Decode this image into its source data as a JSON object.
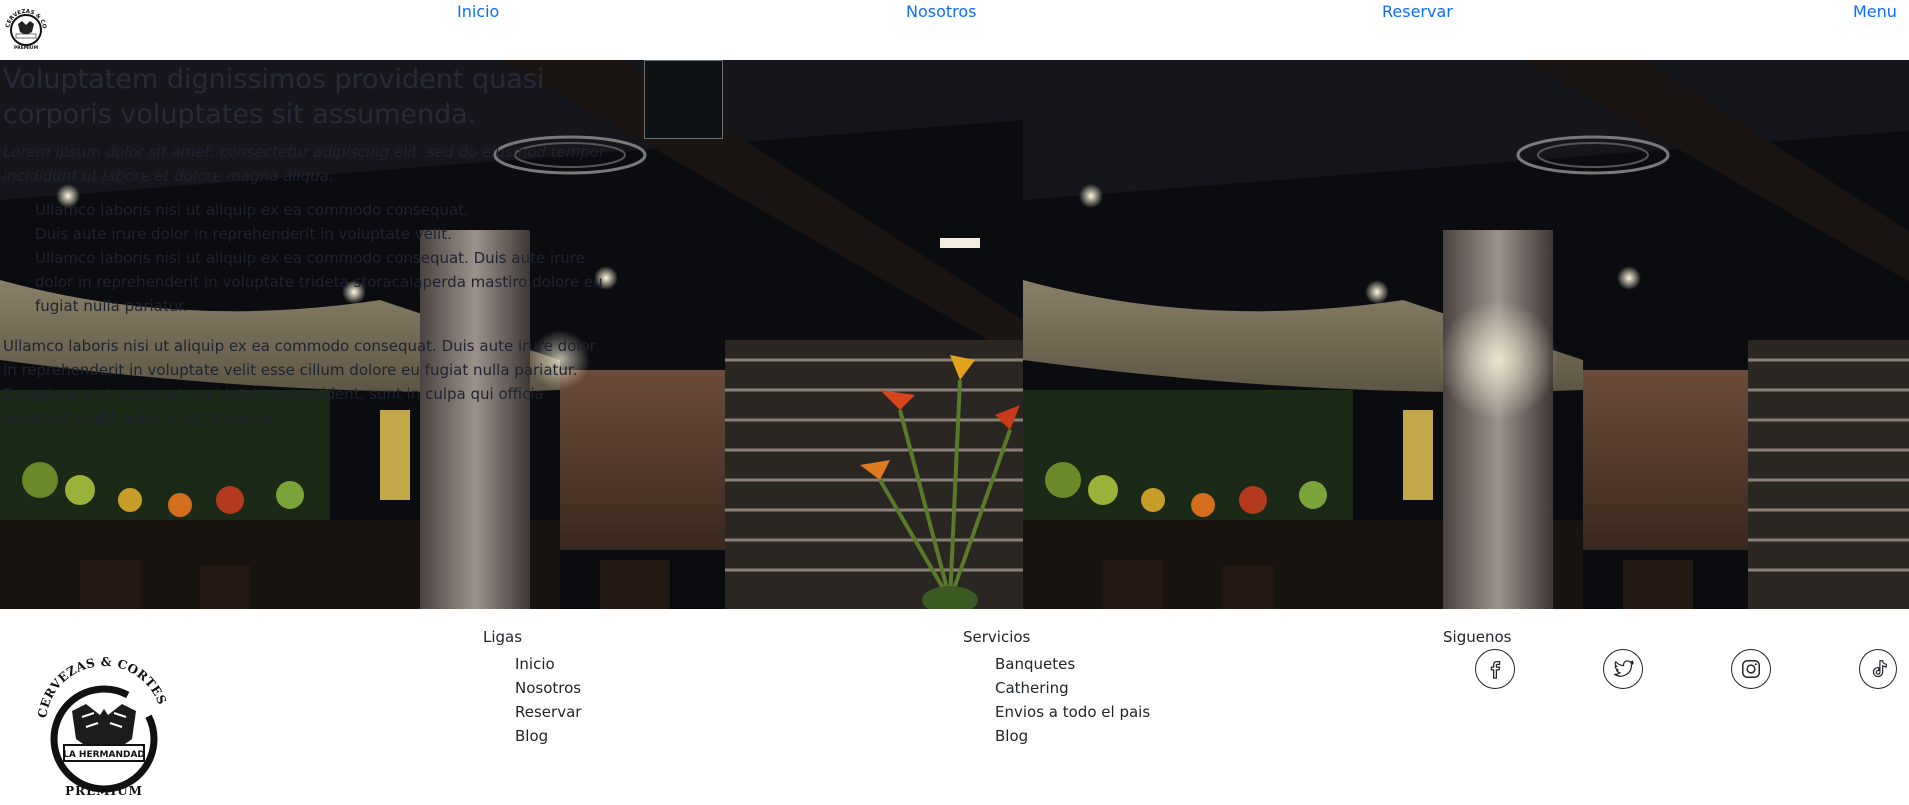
{
  "header": {
    "logo_alt": "Cervezas & Cortes La Hermandad Premium",
    "nav": [
      "Inicio",
      "Nosotros",
      "Reservar",
      "Menu"
    ]
  },
  "hero": {
    "title": "Voluptatem dignissimos provident quasi corporis voluptates sit assumenda.",
    "lead": "Lorem ipsum dolor sit amet, consectetur adipiscing elit, sed do eiusmod tempor incididunt ut labore et dolore magna aliqua.",
    "list": [
      "Ullamco laboris nisi ut aliquip ex ea commodo consequat.",
      "Duis aute irure dolor in reprehenderit in voluptate velit.",
      "Ullamco laboris nisi ut aliquip ex ea commodo consequat. Duis aute irure dolor in reprehenderit in voluptate trideta storacalaperda mastiro dolore eu fugiat nulla pariatur."
    ],
    "paragraph": "Ullamco laboris nisi ut aliquip ex ea commodo consequat. Duis aute irure dolor in reprehenderit in voluptate velit esse cillum dolore eu fugiat nulla pariatur. Excepteur sint occaecat cupidatat non proident, sunt in culpa qui officia deserunt mollit anim id est laborum"
  },
  "footer": {
    "logo": {
      "top_text": "CERVEZAS & CORTES",
      "badge_text": "LA HERMANDAD",
      "bottom_text": "PREMIUM"
    },
    "ligas": {
      "heading": "Ligas",
      "items": [
        "Inicio",
        "Nosotros",
        "Reservar",
        "Blog"
      ]
    },
    "servicios": {
      "heading": "Servicios",
      "items": [
        "Banquetes",
        "Cathering",
        "Envios a todo el pais",
        "Blog"
      ]
    },
    "siguenos": {
      "heading": "Siguenos",
      "icons": [
        "facebook-icon",
        "twitter-icon",
        "instagram-icon",
        "tiktok-icon"
      ]
    }
  },
  "colors": {
    "nav_link": "#0d6efd",
    "hero_text": "#262a38",
    "footer_text": "#212529"
  }
}
